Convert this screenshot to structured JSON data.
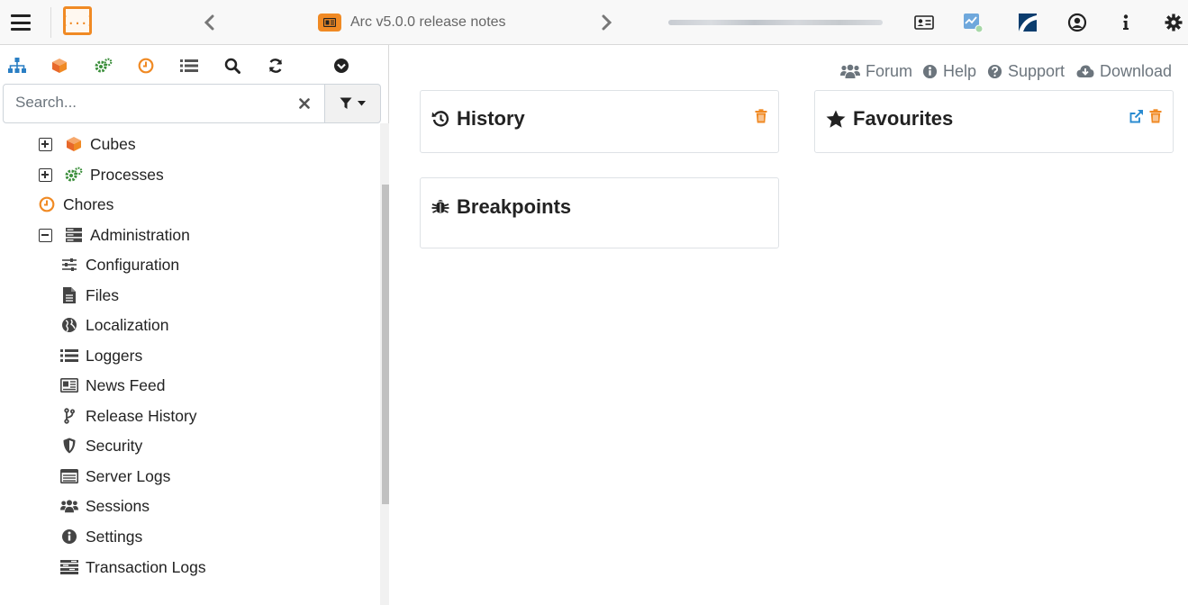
{
  "header": {
    "logo_text": "[...]",
    "title": "Arc v5.0.0 release notes",
    "accent_color": "#f08a24"
  },
  "sidebar": {
    "toolbar_icons": [
      "sitemap-icon",
      "cube-icon",
      "cogs-icon",
      "clock-icon",
      "list-icon",
      "search-icon",
      "refresh-icon",
      "chevron-circle-down-icon"
    ],
    "search": {
      "placeholder": "Search...",
      "value": ""
    },
    "tree": [
      {
        "label": "Cubes",
        "icon": "cube-icon",
        "expander": "plus"
      },
      {
        "label": "Processes",
        "icon": "cogs-icon",
        "expander": "plus"
      },
      {
        "label": "Chores",
        "icon": "clock-icon",
        "expander": "none"
      },
      {
        "label": "Administration",
        "icon": "server-icon",
        "expander": "minus"
      }
    ],
    "admin_children": [
      {
        "label": "Configuration",
        "icon": "sliders-icon"
      },
      {
        "label": "Files",
        "icon": "file-icon"
      },
      {
        "label": "Localization",
        "icon": "globe-icon"
      },
      {
        "label": "Loggers",
        "icon": "list-icon"
      },
      {
        "label": "News Feed",
        "icon": "newspaper-icon"
      },
      {
        "label": "Release History",
        "icon": "code-branch-icon"
      },
      {
        "label": "Security",
        "icon": "shield-icon"
      },
      {
        "label": "Server Logs",
        "icon": "terminal-log-icon"
      },
      {
        "label": "Sessions",
        "icon": "users-icon"
      },
      {
        "label": "Settings",
        "icon": "info-circle-icon"
      },
      {
        "label": "Transaction Logs",
        "icon": "stream-icon"
      }
    ]
  },
  "links": {
    "forum": "Forum",
    "help": "Help",
    "support": "Support",
    "download": "Download"
  },
  "cards": {
    "history": "History",
    "favourites": "Favourites",
    "breakpoints": "Breakpoints"
  }
}
